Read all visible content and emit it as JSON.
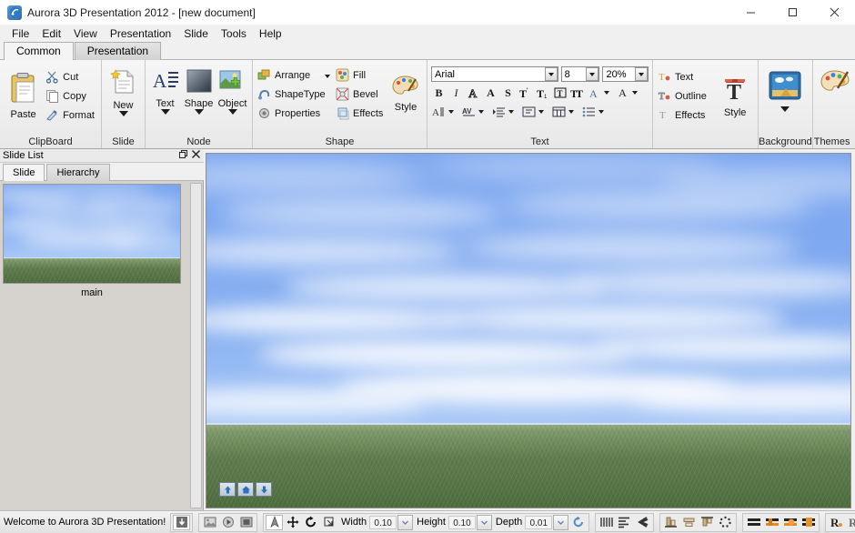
{
  "window": {
    "title": "Aurora 3D Presentation 2012 - [new document]",
    "app_icon": "aurora-logo-icon",
    "minimize_label": "—",
    "maximize_label": "□",
    "close_label": "✕"
  },
  "menu": {
    "items": [
      {
        "label": "File"
      },
      {
        "label": "Edit"
      },
      {
        "label": "View"
      },
      {
        "label": "Presentation"
      },
      {
        "label": "Slide"
      },
      {
        "label": "Tools"
      },
      {
        "label": "Help"
      }
    ]
  },
  "ribbon": {
    "tabs": [
      {
        "label": "Common",
        "active": true
      },
      {
        "label": "Presentation",
        "active": false
      }
    ],
    "groups": {
      "clipboard": {
        "label": "ClipBoard",
        "paste": "Paste",
        "cut": "Cut",
        "copy": "Copy",
        "format": "Format"
      },
      "slide": {
        "label": "Slide",
        "new": "New"
      },
      "node": {
        "label": "Node",
        "text": "Text",
        "shape": "Shape",
        "object": "Object"
      },
      "shape": {
        "label": "Shape",
        "arrange": "Arrange",
        "shapetype": "ShapeType",
        "properties": "Properties",
        "fill": "Fill",
        "bevel": "Bevel",
        "effects": "Effects",
        "style": "Style"
      },
      "text": {
        "label": "Text",
        "font_family": "Arial",
        "font_size": "8",
        "font_scale": "20%",
        "bold": "B",
        "italic": "I",
        "glyph_a_outline": "A",
        "glyph_a_solid": "A",
        "shadow": "S",
        "superscript": "T",
        "subscript": "T",
        "boxed": "T",
        "double_t": "TT",
        "char_style": "A",
        "font_color": "A"
      },
      "textstyle": {
        "text": "Text",
        "outline": "Outline",
        "effects": "Effects",
        "style": "Style"
      },
      "background": {
        "label": "Background"
      },
      "theme": {
        "label": "Themes"
      }
    }
  },
  "slide_list": {
    "panel_title": "Slide List",
    "float_icon": "restore-icon",
    "close_icon": "close-icon",
    "tabs": [
      {
        "label": "Slide",
        "active": true
      },
      {
        "label": "Hierarchy",
        "active": false
      }
    ],
    "slides": [
      {
        "name": "main"
      }
    ]
  },
  "canvas": {
    "nav_buttons": [
      {
        "icon": "arrow-up-icon"
      },
      {
        "icon": "home-icon"
      },
      {
        "icon": "arrow-down-icon"
      }
    ]
  },
  "statusbar": {
    "message": "Welcome to Aurora 3D Presentation!",
    "width_label": "Width",
    "width_value": "0.10",
    "height_label": "Height",
    "height_value": "0.10",
    "depth_label": "Depth",
    "depth_value": "0.01"
  },
  "colors": {
    "sky_top": "#7aa5ef",
    "sky_bottom": "#a9c8f6",
    "ground_top": "#93ab7e",
    "ground_bottom": "#4e6d3e",
    "ribbon_bg": "#f0f0f0",
    "dock_bg": "#d6d3ce",
    "accent_orange": "#e08a22"
  }
}
